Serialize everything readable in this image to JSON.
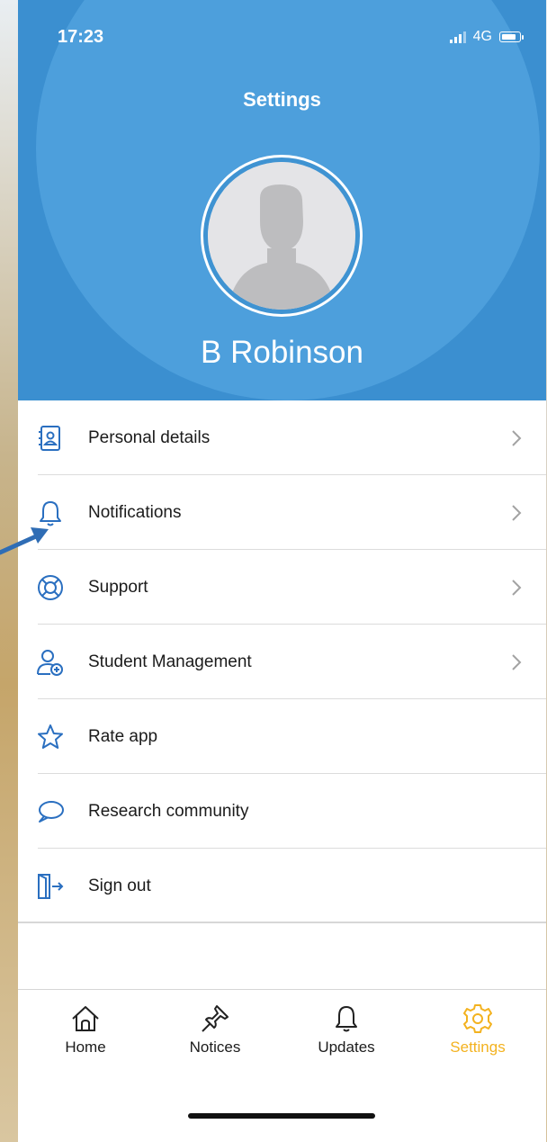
{
  "status_bar": {
    "time": "17:23",
    "network": "4G"
  },
  "header": {
    "title": "Settings",
    "user_name": "B Robinson"
  },
  "menu": {
    "items": [
      {
        "label": "Personal details",
        "icon": "contact-card-icon",
        "chevron": true
      },
      {
        "label": "Notifications",
        "icon": "bell-icon",
        "chevron": true
      },
      {
        "label": "Support",
        "icon": "lifebuoy-icon",
        "chevron": true
      },
      {
        "label": "Student Management",
        "icon": "user-add-icon",
        "chevron": true
      },
      {
        "label": "Rate app",
        "icon": "star-icon",
        "chevron": false
      },
      {
        "label": "Research community",
        "icon": "chat-bubble-icon",
        "chevron": false
      },
      {
        "label": "Sign out",
        "icon": "sign-out-icon",
        "chevron": false
      }
    ]
  },
  "tabbar": {
    "tabs": [
      {
        "label": "Home",
        "icon": "home-icon",
        "active": false
      },
      {
        "label": "Notices",
        "icon": "pin-icon",
        "active": false
      },
      {
        "label": "Updates",
        "icon": "bell-icon",
        "active": false
      },
      {
        "label": "Settings",
        "icon": "gear-icon",
        "active": true
      }
    ]
  },
  "colors": {
    "header_blue": "#3b8fd0",
    "icon_blue": "#2a6fc0",
    "active_tab": "#f3b21f"
  }
}
